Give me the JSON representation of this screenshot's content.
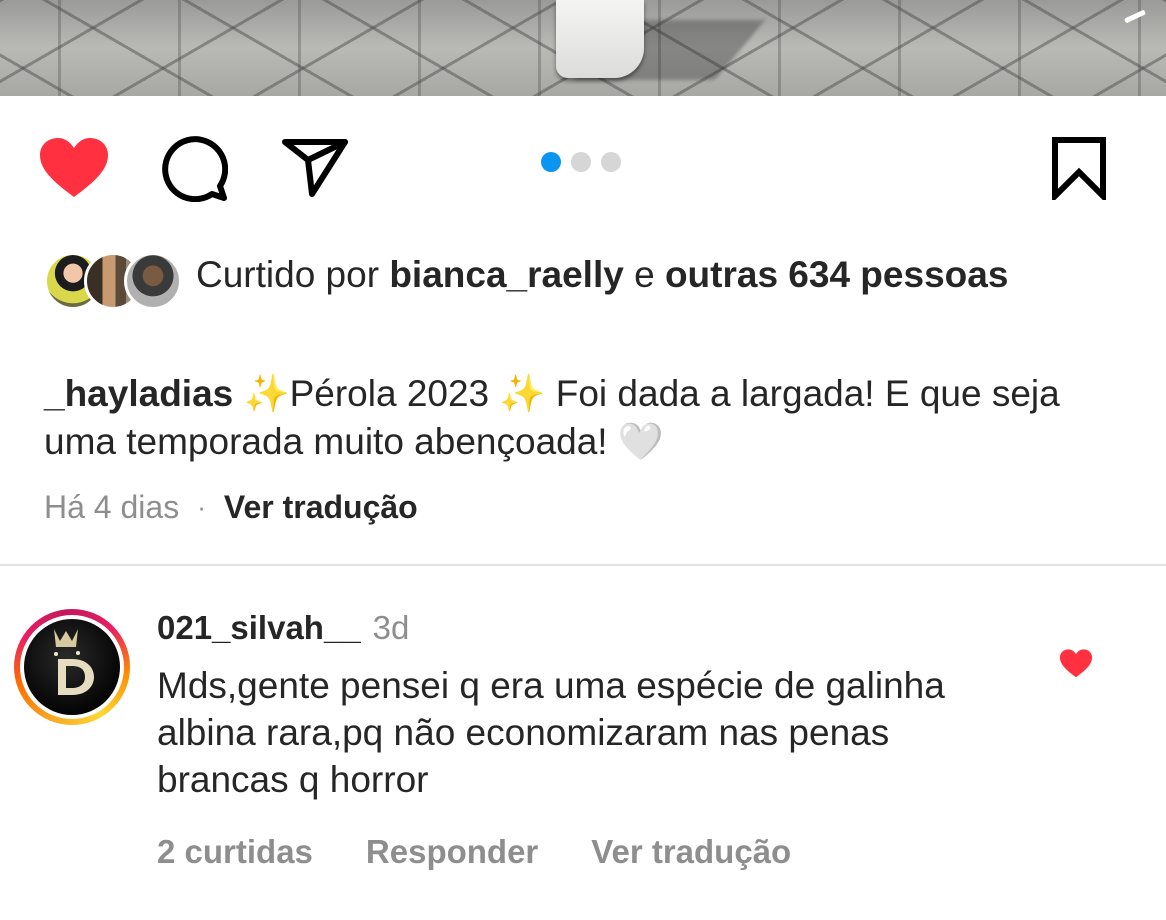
{
  "post": {
    "likes": {
      "prefix": "Curtido por ",
      "user": "bianca_raelly",
      "connector": " e ",
      "others": "outras 634 pessoas"
    },
    "caption": {
      "username": "_hayladias",
      "text": " ✨Pérola 2023 ✨ Foi dada a largada! E que seja uma temporada muito abençoada! 🤍"
    },
    "time": "Há 4 dias",
    "separator": "·",
    "translate": "Ver tradução",
    "carousel": {
      "count": 3,
      "active": 1
    }
  },
  "comment": {
    "username": "021_silvah__",
    "time": "3d",
    "text": "Mds,gente pensei q era uma espécie de galinha albina rara,pq não economizaram nas penas brancas q horror",
    "likes": "2 curtidas",
    "reply": "Responder",
    "translate": "Ver tradução"
  },
  "colors": {
    "like_red": "#ff3040",
    "carousel_active": "#0a95f0",
    "carousel_inactive": "#d6d6d6",
    "secondary_text": "#8e8e8e"
  },
  "icons": {
    "like": "heart-filled-icon",
    "comment": "comment-bubble-icon",
    "share": "paper-plane-icon",
    "save": "bookmark-icon",
    "comment_like": "heart-filled-icon"
  }
}
